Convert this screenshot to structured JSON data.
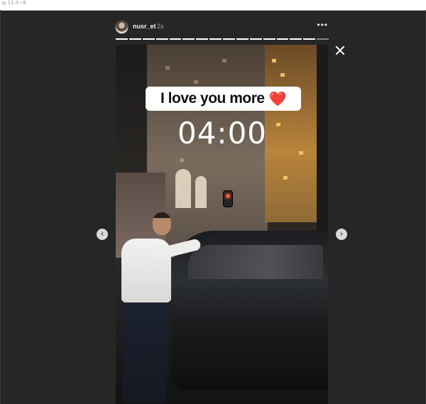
{
  "window": {
    "title": "ig 11:5~8"
  },
  "story": {
    "username": "nusr_et",
    "timestamp": "2s",
    "more_icon": "more-options-icon",
    "progress_segments_total": 16,
    "progress_segments_done": 15,
    "sticker_text": "I love you more",
    "sticker_emoji": "❤️",
    "countdown": "04:00"
  },
  "nav": {
    "prev_icon": "chevron-left-icon",
    "next_icon": "chevron-right-icon",
    "close_icon": "close-icon"
  },
  "colors": {
    "background": "#262626",
    "heart": "#e2332a",
    "sticker_bg": "#ffffff"
  }
}
